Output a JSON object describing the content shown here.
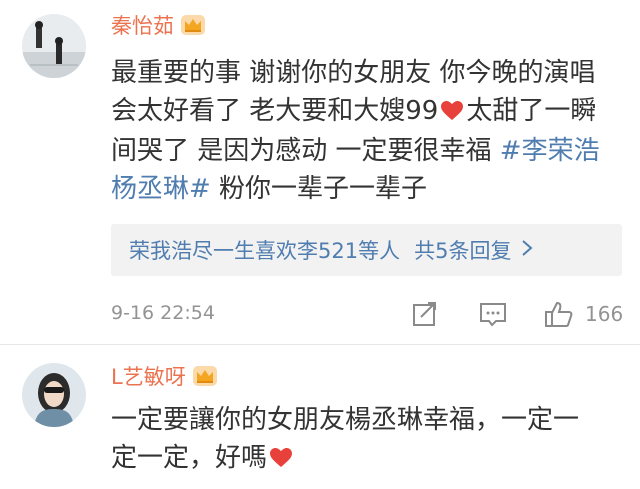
{
  "comments": [
    {
      "username": "秦怡茹",
      "text_parts": [
        "最重要的事 谢谢你的女朋友 你今晚的演唱会太好看了 老大要和大嫂99",
        "太甜了一瞬间哭了 是因为感动 一定要很幸福 ",
        "#李荣浩杨丞琳#",
        " 粉你一辈子一辈子"
      ],
      "replies_summary": "荣我浩尽一生喜欢李521等人",
      "replies_count": "共5条回复",
      "timestamp": "9-16 22:54",
      "likes": "166"
    },
    {
      "username": "L艺敏呀",
      "text_parts": [
        "一定要讓你的女朋友楊丞琳幸福，一定一定一定，好嗎"
      ]
    }
  ],
  "colors": {
    "username": "#eb7350",
    "link": "#507daf",
    "text": "#333333",
    "meta": "#939393",
    "heart": "#e8403a",
    "crown": "#f4a623"
  },
  "icons": {
    "vip_badge": "crown-icon",
    "heart": "heart-icon",
    "share": "share-icon",
    "reply": "comment-icon",
    "like": "thumbs-up-icon",
    "chevron": "chevron-right-icon"
  }
}
